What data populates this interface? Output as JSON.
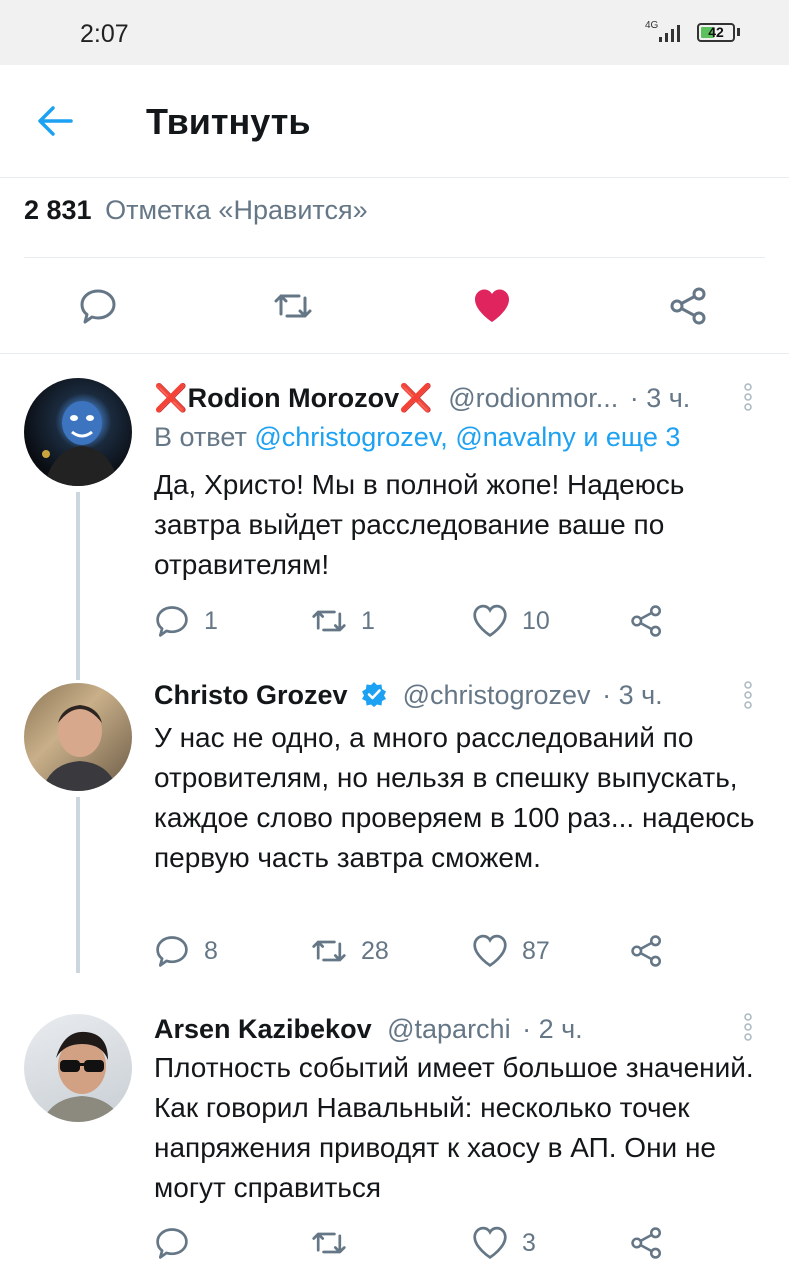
{
  "status": {
    "time": "2:07",
    "network": "4G",
    "battery": "42",
    "battery_level": 0.42
  },
  "header": {
    "title": "Твитнуть"
  },
  "stats": {
    "likes_count": "2 831",
    "likes_label": "Отметка «Нравится»"
  },
  "tweets": [
    {
      "name_prefix": "❌",
      "name": "Rodion Morozov",
      "name_suffix": "❌",
      "handle": "@rodionmor...",
      "time": "· 3 ч.",
      "reply_prefix": "В ответ",
      "reply_mentions": "@christogrozev, @navalny",
      "reply_suffix": "и еще 3",
      "body": "Да, Христо! Мы в полной жопе! Надеюсь завтра выйдет расследование ваше по отравителям!",
      "replies": "1",
      "retweets": "1",
      "likes": "10"
    },
    {
      "name": "Christo Grozev",
      "verified": true,
      "handle": "@christogrozev",
      "time": "· 3 ч.",
      "body": "У нас не одно, а много расследований по отровителям, но нельзя в спешку выпускать, каждое слово проверяем в 100 раз... надеюсь первую часть завтра сможем.",
      "replies": "8",
      "retweets": "28",
      "likes": "87"
    },
    {
      "name": "Arsen Kazibekov",
      "handle": "@taparchi",
      "time": "· 2 ч.",
      "body": "Плотность событий имеет большое значений. Как говорил Навальный: несколько точек напряжения приводят к хаосу в АП. Они не могут справиться",
      "replies": "",
      "retweets": "",
      "likes": "3"
    }
  ],
  "colors": {
    "accent": "#1da1f2",
    "like_active": "#e0245e",
    "muted": "#657786"
  }
}
